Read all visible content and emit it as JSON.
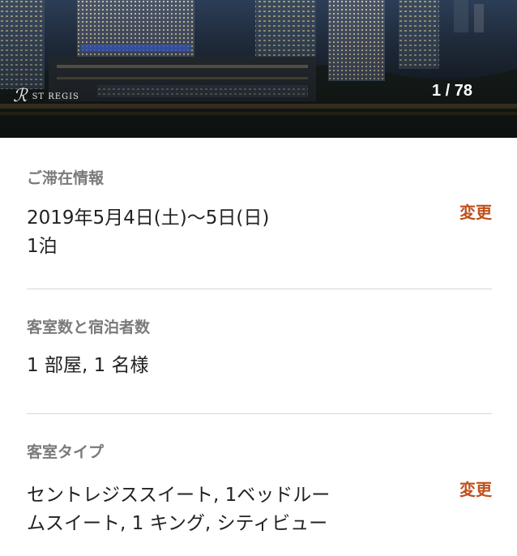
{
  "hero": {
    "brand": "ST REGIS",
    "brand_mark": "ℛ",
    "photo_counter": "1 / 78"
  },
  "stay": {
    "label": "ご滞在情報",
    "dates": "2019年5月4日(土)〜5日(日)",
    "nights": "1泊",
    "change": "変更"
  },
  "rooms": {
    "label": "客室数と宿泊者数",
    "value": "1 部屋, 1 名様"
  },
  "room_type": {
    "label": "客室タイプ",
    "line1": "セントレジススイート, 1ベッドルー",
    "line2": "ムスイート, 1 キング, シティビュー",
    "change": "変更"
  },
  "colors": {
    "accent": "#c0501b",
    "label_gray": "#7a7a7a",
    "text": "#222222",
    "divider": "#d6d6d6"
  }
}
